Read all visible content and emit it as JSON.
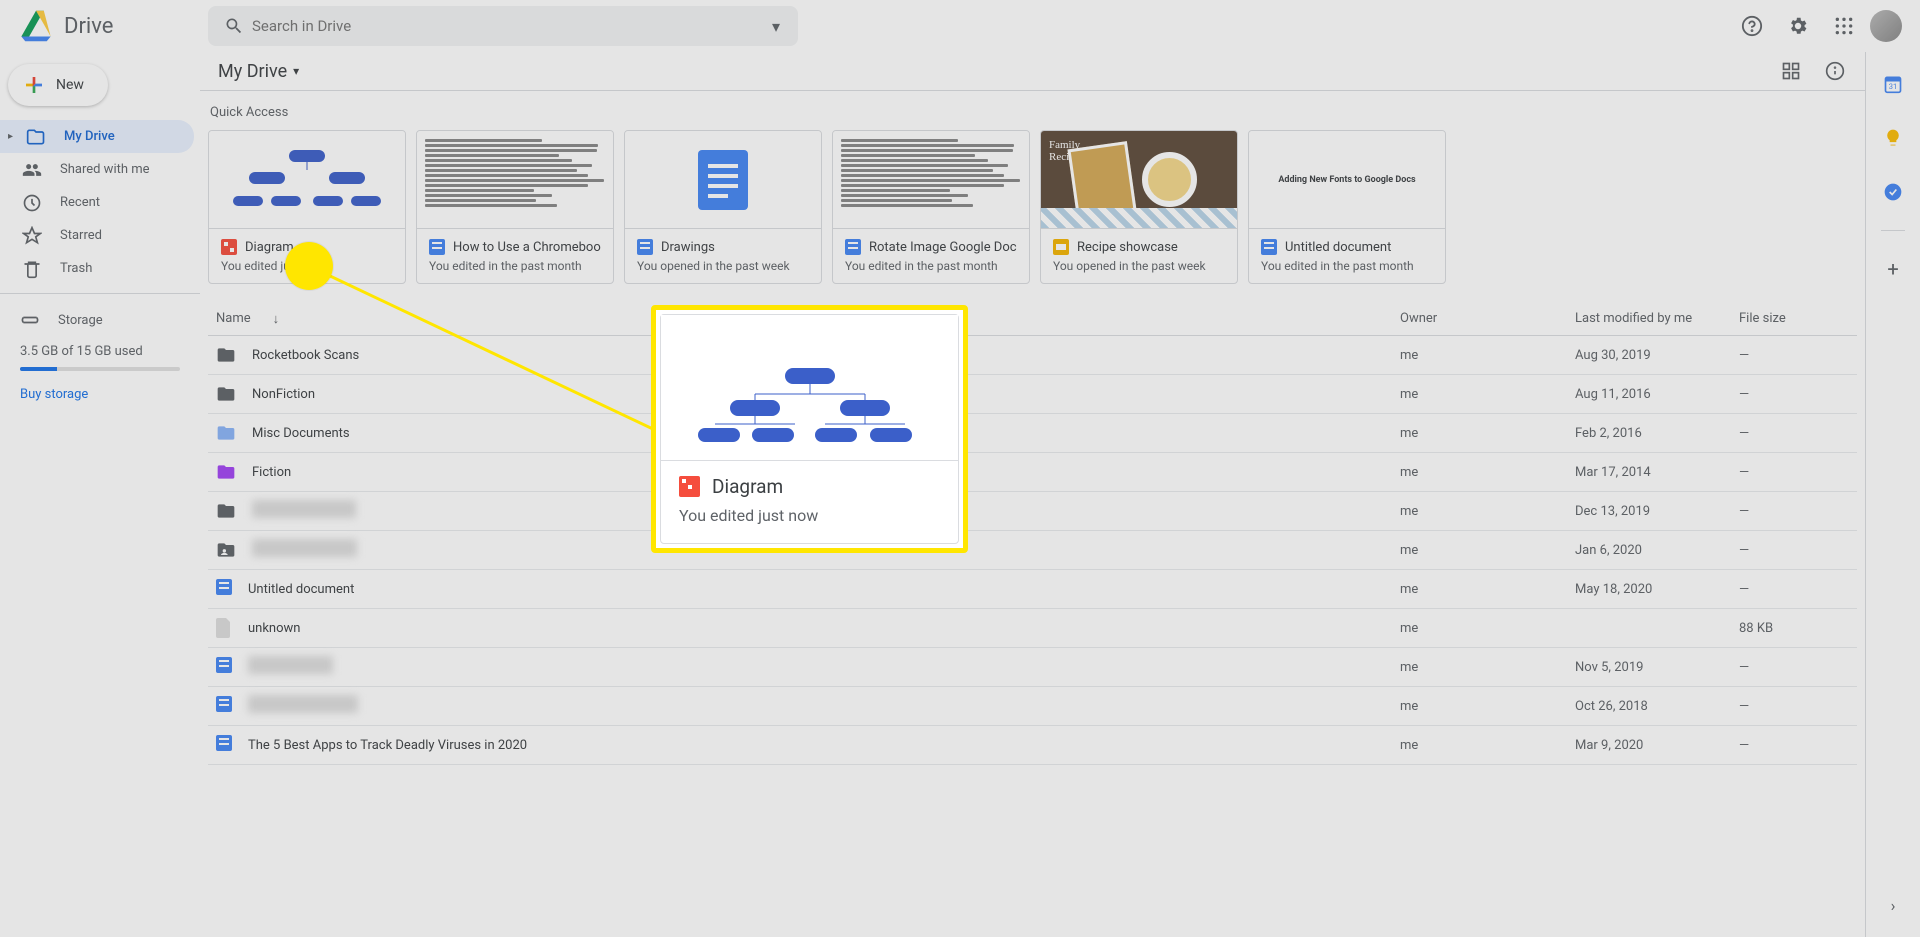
{
  "app": {
    "name": "Drive",
    "search_placeholder": "Search in Drive"
  },
  "sidebar": {
    "new_label": "New",
    "items": [
      {
        "label": "My Drive"
      },
      {
        "label": "Shared with me"
      },
      {
        "label": "Recent"
      },
      {
        "label": "Starred"
      },
      {
        "label": "Trash"
      }
    ],
    "storage_label": "Storage",
    "storage_used": "3.5 GB of 15 GB used",
    "buy_label": "Buy storage"
  },
  "path": {
    "title": "My Drive"
  },
  "quick_access": {
    "title": "Quick Access",
    "cards": [
      {
        "name": "Diagram",
        "sub": "You edited just now",
        "type": "drawio"
      },
      {
        "name": "How to Use a Chromebook O…",
        "sub": "You edited in the past month",
        "type": "docs"
      },
      {
        "name": "Drawings",
        "sub": "You opened in the past week",
        "type": "docs"
      },
      {
        "name": "Rotate Image Google Docs",
        "sub": "You edited in the past month",
        "type": "docs"
      },
      {
        "name": "Recipe showcase",
        "sub": "You opened in the past week",
        "type": "slides"
      },
      {
        "name": "Untitled document",
        "sub": "You edited in the past month",
        "type": "docs"
      }
    ]
  },
  "table": {
    "headers": {
      "name": "Name",
      "owner": "Owner",
      "modified": "Last modified by me",
      "size": "File size"
    },
    "rows": [
      {
        "name": "Rocketbook Scans",
        "owner": "me",
        "modified": "Aug 30, 2019",
        "size": "—",
        "icon": "folder"
      },
      {
        "name": "NonFiction",
        "owner": "me",
        "modified": "Aug 11, 2016",
        "size": "—",
        "icon": "folder"
      },
      {
        "name": "Misc Documents",
        "owner": "me",
        "modified": "Feb 2, 2016",
        "size": "—",
        "icon": "folder-blue"
      },
      {
        "name": "Fiction",
        "owner": "me",
        "modified": "Mar 17, 2014",
        "size": "—",
        "icon": "folder-purple"
      },
      {
        "name": "",
        "owner": "me",
        "modified": "Dec 13, 2019",
        "size": "—",
        "icon": "folder",
        "redacted": true
      },
      {
        "name": "",
        "owner": "me",
        "modified": "Jan 6, 2020",
        "size": "—",
        "icon": "shared-folder",
        "redacted": true
      },
      {
        "name": "Untitled document",
        "owner": "me",
        "modified": "May 18, 2020",
        "size": "—",
        "icon": "docs"
      },
      {
        "name": "unknown",
        "owner": "me",
        "modified": "",
        "size": "88 KB",
        "icon": "unknown"
      },
      {
        "name": "",
        "owner": "me",
        "modified": "Nov 5, 2019",
        "size": "—",
        "icon": "docs",
        "redacted": true
      },
      {
        "name": "",
        "owner": "me",
        "modified": "Oct 26, 2018",
        "size": "—",
        "icon": "docs",
        "redacted": true
      },
      {
        "name": "The 5 Best Apps to Track Deadly Viruses in 2020",
        "owner": "me",
        "modified": "Mar 9, 2020",
        "size": "—",
        "icon": "docs"
      }
    ]
  },
  "callout": {
    "name": "Diagram",
    "sub": "You edited just now"
  },
  "slides_thumb": {
    "title": "Family Recipes"
  },
  "docs_thumb_untitled": {
    "text": "Adding New Fonts to Google Docs"
  }
}
